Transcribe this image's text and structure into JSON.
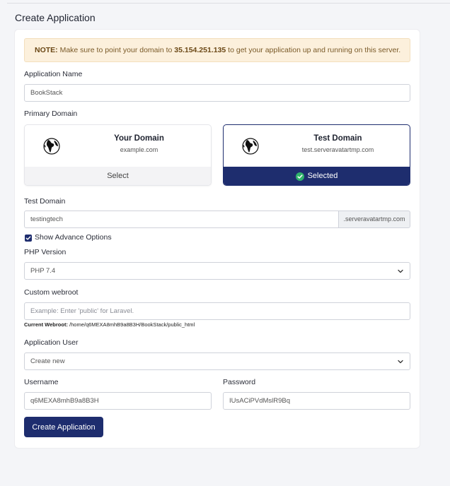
{
  "page": {
    "title": "Create Application"
  },
  "notice": {
    "prefix": "NOTE:",
    "text_before": " Make sure to point your domain to ",
    "ip": "35.154.251.135",
    "text_after": " to get your application up and running on this server."
  },
  "form": {
    "app_name": {
      "label": "Application Name",
      "value": "BookStack"
    },
    "primary_domain": {
      "label": "Primary Domain",
      "options": [
        {
          "title": "Your Domain",
          "subtitle": "example.com",
          "action": "Select"
        },
        {
          "title": "Test Domain",
          "subtitle": "test.serveravatartmp.com",
          "action": "Selected"
        }
      ]
    },
    "test_domain": {
      "label": "Test Domain",
      "value": "testingtech",
      "suffix": ".serveravatartmp.com"
    },
    "advance_options": {
      "label": "Show Advance Options",
      "checked": true
    },
    "php_version": {
      "label": "PHP Version",
      "value": "PHP 7.4"
    },
    "webroot": {
      "label": "Custom webroot",
      "placeholder": "Example: Enter 'public' for Laravel.",
      "hint_label": "Current Webroot:",
      "hint_value": " /home/q6MEXA8mhB9a8B3H/BookStack/public_html"
    },
    "app_user": {
      "label": "Application User",
      "value": "Create new"
    },
    "username": {
      "label": "Username",
      "value": "q6MEXA8mhB9a8B3H"
    },
    "password": {
      "label": "Password",
      "value": "IUsACiPVdMslR9Bq"
    },
    "submit_label": "Create Application"
  },
  "colors": {
    "primary": "#1e2d6e",
    "notice_bg": "#fcf0dc",
    "page_bg": "#f4f5f8"
  }
}
